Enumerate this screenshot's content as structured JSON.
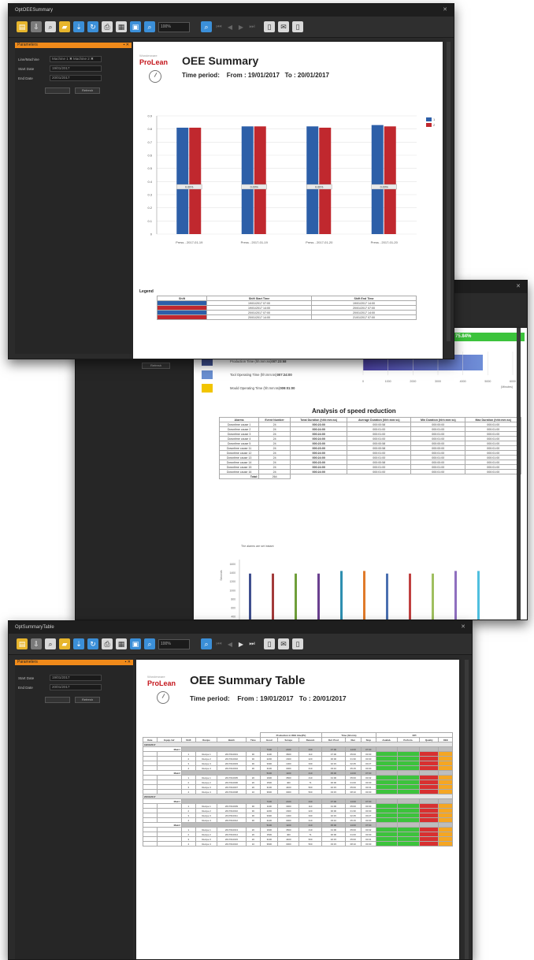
{
  "win1": {
    "title": "OptOEESummary",
    "zoom": "100%",
    "panel_header": "Parameters",
    "filters": [
      {
        "label": "Line/Machine",
        "value": "Machine 1 ✖  Machine 2 ✖"
      },
      {
        "label": "Start Date",
        "value": "19/01/2017"
      },
      {
        "label": "End Date",
        "value": "20/01/2017"
      }
    ],
    "refresh_button": "Refresh",
    "report": {
      "logo_top": "Wonderware",
      "logo_main": "ProLean",
      "title": "OEE Summary",
      "period_label": "Time period:",
      "period_from": "From : 19/01/2017",
      "period_to": "To : 20/01/2017",
      "legend_title": "Legend",
      "legend_headers": [
        "Shift",
        "Shift Start Time",
        "Shift End Time"
      ],
      "legend_rows": [
        {
          "color": "#2d5fa8",
          "start": "19/01/2017 07:00",
          "end": "19/01/2017 14:00"
        },
        {
          "color": "#c0282e",
          "start": "19/01/2017 14:00",
          "end": "20/01/2017 07:00"
        },
        {
          "color": "#2d5fa8",
          "start": "20/01/2017 07:00",
          "end": "20/01/2017 14:00"
        },
        {
          "color": "#c0282e",
          "start": "20/01/2017 14:00",
          "end": "21/01/2017 07:00"
        }
      ]
    }
  },
  "chart_data": {
    "type": "bar",
    "categories": [
      "Press - 2017-01-19",
      "Press - 2017-01-19",
      "Press - 2017-01-20",
      "Press - 2017-01-20"
    ],
    "series": [
      {
        "name": "1",
        "color": "#2d5fa8",
        "values": [
          0.81,
          0.82,
          0.82,
          0.83
        ]
      },
      {
        "name": "2",
        "color": "#c0282e",
        "values": [
          0.81,
          0.82,
          0.81,
          0.82
        ]
      }
    ],
    "yticks": [
      "0",
      "0.1",
      "0.2",
      "0.3",
      "0.4",
      "0.5",
      "0.6",
      "0.7",
      "0.8",
      "0.9"
    ],
    "ylim": [
      0,
      0.9
    ],
    "bar_label": "0.00%",
    "legend_position": "top-right",
    "grid": true
  },
  "win2": {
    "badge": "75.84%",
    "refresh_button": "Refresh",
    "time_items": [
      {
        "color": "#3f4f8f",
        "label": "Production Time (hh:mm:ss)",
        "value": "007:23:58"
      },
      {
        "color": "#6a8fd0",
        "label": "Tool Operating Time (hh:mm:ss)",
        "value": "007:24:00"
      },
      {
        "color": "#f2c500",
        "label": "Mould Operating Time (hh:mm:ss)",
        "value": "009:01:00"
      }
    ],
    "hbar_ticks": [
      "0",
      "1000",
      "2000",
      "3000",
      "4000",
      "5000",
      "6000"
    ],
    "hbar_unit": "(Minutes)",
    "speed_title": "Analysis of speed reduction",
    "speed_headers": [
      "Alarms",
      "Event Number",
      "Total Duration (hhh:mm:ss)",
      "Average Duration (hhh:mm:ss)",
      "Min Duration (hhh:mm:ss)",
      "Max Duration (hhh:mm:ss)"
    ],
    "speed_rows": [
      [
        "Downtime cause 1",
        "24",
        "000:23:00",
        "000:00:58",
        "000:00:00",
        "000:01:00"
      ],
      [
        "Downtime cause 2",
        "24",
        "000:24:00",
        "000:01:00",
        "000:01:00",
        "000:01:00"
      ],
      [
        "Downtime cause 3",
        "24",
        "000:24:00",
        "000:01:00",
        "000:01:00",
        "000:01:00"
      ],
      [
        "Downtime cause 4",
        "24",
        "000:24:00",
        "000:01:00",
        "000:01:00",
        "000:01:00"
      ],
      [
        "Downtime cause 5",
        "24",
        "000:23:00",
        "000:00:58",
        "000:00:00",
        "000:01:00"
      ],
      [
        "Downtime cause 11",
        "24",
        "000:23:00",
        "000:00:58",
        "000:00:00",
        "000:01:00"
      ],
      [
        "Downtime cause 12",
        "24",
        "000:24:00",
        "000:01:00",
        "000:01:00",
        "000:01:00"
      ],
      [
        "Downtime cause 13",
        "24",
        "000:24:00",
        "000:01:00",
        "000:01:00",
        "000:01:00"
      ],
      [
        "Downtime cause 14",
        "24",
        "000:23:00",
        "000:00:58",
        "000:00:00",
        "000:01:00"
      ],
      [
        "Downtime cause 15",
        "24",
        "000:24:00",
        "000:01:00",
        "000:01:00",
        "000:01:00"
      ],
      [
        "Downtime cause 16",
        "24",
        "000:24:00",
        "000:01:00",
        "000:01:00",
        "000:01:00"
      ]
    ],
    "total_label": "Total:",
    "total_value": "264",
    "footnote": "The alarms are set instant",
    "vbar_yticks": [
      "1600",
      "1400",
      "1200",
      "1000",
      "800",
      "600",
      "400"
    ],
    "vbar_ylabel": "Seconds",
    "vbar_colors": [
      "#3f4f8f",
      "#a33a3a",
      "#6f9f3a",
      "#6a3f8f",
      "#2e8fb0",
      "#e07a2a",
      "#4a6fb0",
      "#c04040",
      "#9fbf5f",
      "#8f6fbf",
      "#4fbfdf"
    ],
    "vbar_values": [
      1380,
      1380,
      1380,
      1380,
      1440,
      1440,
      1380,
      1380,
      1380,
      1440,
      1440
    ]
  },
  "win3": {
    "title": "OptSummaryTable",
    "zoom": "100%",
    "panel_header": "Parameters",
    "filters": [
      {
        "label": "Start Date",
        "value": "19/01/2017"
      },
      {
        "label": "End Date",
        "value": "20/01/2017"
      }
    ],
    "refresh_button": "Refresh",
    "report": {
      "logo_top": "Wonderware",
      "logo_main": "ProLean",
      "title": "OEE Summary Table",
      "period_label": "Time period:",
      "period_from": "From : 19/01/2017",
      "period_to": "To : 20/01/2017",
      "group_headers": [
        "Production in OEE time(Pc)",
        "Time (hh:mm)",
        "KPI"
      ],
      "headers": [
        "Date",
        "Equip./ref",
        "Shift",
        "Recipe",
        "Batch",
        "Time",
        "Good",
        "Scraps",
        "Rework",
        "Def. Prod",
        "Run",
        "Stop",
        "Availab.",
        "Perform.",
        "Quality",
        "OEE"
      ],
      "rows": [
        {
          "type": "date",
          "label": "19/01/2017"
        },
        {
          "type": "shift",
          "label": "Main1",
          "vals": [
            "7100",
            "2100",
            "440",
            "07:00",
            "14:00",
            "07:00"
          ]
        },
        {
          "type": "data",
          "vals": [
            "1",
            "Recipe 1",
            "2017010001",
            "30",
            "1100",
            "3600",
            "110",
            "07:00",
            "05:00",
            "00:30"
          ]
        },
        {
          "type": "data",
          "vals": [
            "2",
            "Recipe 2",
            "2017010002",
            "30",
            "2200",
            "1600",
            "220",
            "00:00",
            "01:30",
            "00:30"
          ]
        },
        {
          "type": "data",
          "vals": [
            "3",
            "Recipe 3",
            "2017010003",
            "30",
            "3300",
            "1300",
            "330",
            "02:15",
            "02:45",
            "00:27"
          ]
        },
        {
          "type": "data",
          "vals": [
            "4",
            "Recipe 4",
            "2017010004",
            "30",
            "3100",
            "3000",
            "310",
            "03:10",
            "05:15",
            "00:30"
          ]
        },
        {
          "type": "shift",
          "label": "Main2",
          "vals": [
            "5100",
            "1100",
            "410",
            "05:00",
            "14:00",
            "07:00"
          ]
        },
        {
          "type": "data",
          "vals": [
            "1",
            "Recipe 1",
            "2017010005",
            "20",
            "1600",
            "3500",
            "410",
            "01:00",
            "05:00",
            "00:32"
          ]
        },
        {
          "type": "data",
          "vals": [
            "2",
            "Recipe 2",
            "2017010006",
            "20",
            "1500",
            "400",
            "71",
            "00:00",
            "01:00",
            "00:30"
          ]
        },
        {
          "type": "data",
          "vals": [
            "3",
            "Recipe 3",
            "2017010007",
            "20",
            "3100",
            "4400",
            "500",
            "02:15",
            "05:00",
            "00:31"
          ]
        },
        {
          "type": "data",
          "vals": [
            "4",
            "Recipe 4",
            "2017010008",
            "10",
            "3600",
            "3000",
            "500",
            "03:15",
            "08:10",
            "00:30"
          ]
        },
        {
          "type": "date",
          "label": "20/01/2017"
        },
        {
          "type": "shift",
          "label": "Main1",
          "vals": [
            "7100",
            "2100",
            "440",
            "07:00",
            "14:00",
            "07:00"
          ]
        },
        {
          "type": "data",
          "vals": [
            "1",
            "Recipe 1",
            "2017010009",
            "30",
            "1100",
            "3300",
            "110",
            "01:00",
            "05:00",
            "00:30"
          ]
        },
        {
          "type": "data",
          "vals": [
            "2",
            "Recipe 2",
            "2017010010",
            "30",
            "2200",
            "1600",
            "220",
            "00:00",
            "01:30",
            "00:30"
          ]
        },
        {
          "type": "data",
          "vals": [
            "3",
            "Recipe 3",
            "2017010011",
            "30",
            "3300",
            "1300",
            "330",
            "02:15",
            "02:45",
            "00:27"
          ]
        },
        {
          "type": "data",
          "vals": [
            "4",
            "Recipe 4",
            "2017010012",
            "30",
            "3100",
            "3000",
            "310",
            "03:10",
            "05:15",
            "00:30"
          ]
        },
        {
          "type": "shift",
          "label": "Main2",
          "vals": [
            "5100",
            "1100",
            "410",
            "05:00",
            "14:00",
            "07:00"
          ]
        },
        {
          "type": "data",
          "vals": [
            "1",
            "Recipe 1",
            "2017010013",
            "20",
            "1600",
            "3500",
            "410",
            "01:00",
            "05:00",
            "00:32"
          ]
        },
        {
          "type": "data",
          "vals": [
            "2",
            "Recipe 2",
            "2017010014",
            "20",
            "1500",
            "400",
            "71",
            "00:00",
            "01:00",
            "00:30"
          ]
        },
        {
          "type": "data",
          "vals": [
            "3",
            "Recipe 3",
            "2017010015",
            "20",
            "3100",
            "4400",
            "500",
            "02:15",
            "05:00",
            "00:31"
          ]
        },
        {
          "type": "data",
          "vals": [
            "4",
            "Recipe 4",
            "2017010016",
            "10",
            "3600",
            "3000",
            "500",
            "03:15",
            "08:10",
            "00:30"
          ]
        }
      ]
    }
  }
}
